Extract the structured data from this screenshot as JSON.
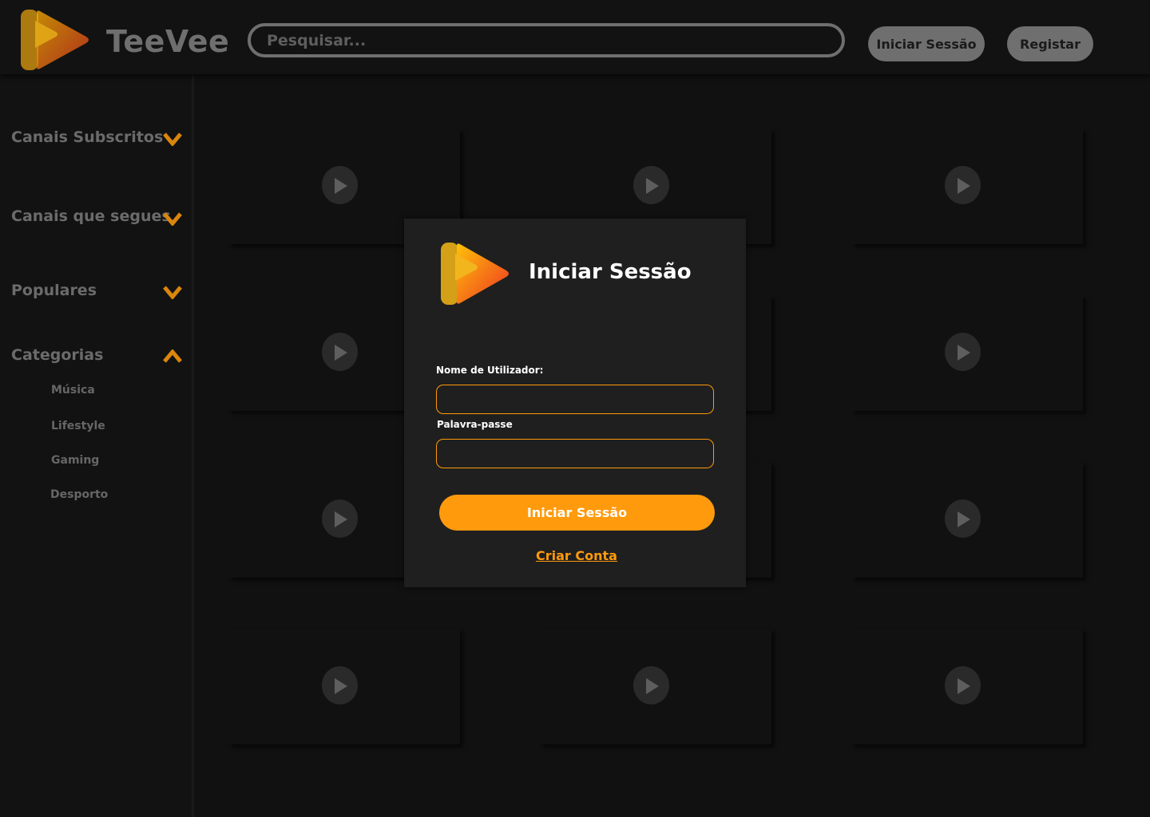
{
  "header": {
    "brand": "TeeVee",
    "search_placeholder": "Pesquisar...",
    "login_label": "Iniciar Sessão",
    "register_label": "Registar"
  },
  "sidebar": {
    "sections": [
      {
        "label": "Canais Subscritos",
        "state": "collapsed"
      },
      {
        "label": "Canais que segues",
        "state": "collapsed"
      },
      {
        "label": "Populares",
        "state": "collapsed"
      },
      {
        "label": "Categorias",
        "state": "expanded"
      }
    ],
    "categories": [
      "Música",
      "Lifestyle",
      "Gaming",
      "Desporto"
    ]
  },
  "grid": {
    "rows": 4,
    "columns": 3,
    "placeholder_icon": "play-icon"
  },
  "modal": {
    "title": "Iniciar Sessão",
    "username_label": "Nome de Utilizador:",
    "username_value": "",
    "password_label": "Palavra-passe",
    "password_value": "",
    "submit_label": "Iniciar Sessão",
    "create_account_label": "Criar Conta"
  },
  "colors": {
    "accent": "#ff9a0d",
    "background": "#111111",
    "modal_background": "#1f1f1f",
    "muted_text": "#6f6f6f"
  }
}
